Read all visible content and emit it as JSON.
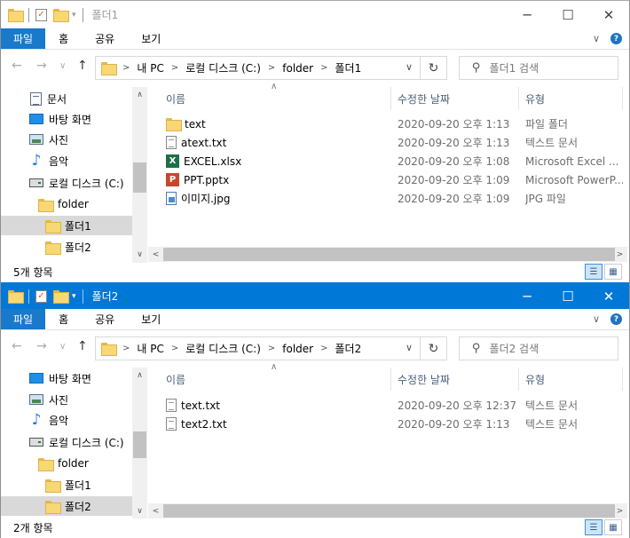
{
  "windows": [
    {
      "title": "폴더1",
      "ribbon_tabs": [
        "파일",
        "홈",
        "공유",
        "보기"
      ],
      "address": {
        "crumbs": [
          "내 PC",
          "로컬 디스크 (C:)",
          "folder",
          "폴더1"
        ]
      },
      "search_placeholder": "폴더1 검색",
      "columns": {
        "name": "이름",
        "date": "수정한 날짜",
        "type": "유형"
      },
      "nav_items": [
        {
          "label": "문서",
          "icon": "documents-icon",
          "selected": false
        },
        {
          "label": "바탕 화면",
          "icon": "desktop-icon",
          "selected": false
        },
        {
          "label": "사진",
          "icon": "pictures-icon",
          "selected": false
        },
        {
          "label": "음악",
          "icon": "music-icon",
          "selected": false
        },
        {
          "label": "로컬 디스크 (C:)",
          "icon": "drive-icon",
          "selected": false
        },
        {
          "label": "folder",
          "icon": "folder-icon",
          "selected": false
        },
        {
          "label": "폴더1",
          "icon": "folder-icon",
          "selected": true
        },
        {
          "label": "폴더2",
          "icon": "folder-icon",
          "selected": false
        }
      ],
      "files": [
        {
          "name": "text",
          "date": "2020-09-20 오후 1:13",
          "type": "파일 폴더",
          "icon": "folder-icon"
        },
        {
          "name": "atext.txt",
          "date": "2020-09-20 오후 1:13",
          "type": "텍스트 문서",
          "icon": "text-file-icon"
        },
        {
          "name": "EXCEL.xlsx",
          "date": "2020-09-20 오후 1:08",
          "type": "Microsoft Excel ...",
          "icon": "excel-file-icon"
        },
        {
          "name": "PPT.pptx",
          "date": "2020-09-20 오후 1:09",
          "type": "Microsoft PowerP...",
          "icon": "powerpoint-file-icon"
        },
        {
          "name": "이미지.jpg",
          "date": "2020-09-20 오후 1:09",
          "type": "JPG 파일",
          "icon": "image-file-icon"
        }
      ],
      "status": "5개 항목"
    },
    {
      "title": "폴더2",
      "ribbon_tabs": [
        "파일",
        "홈",
        "공유",
        "보기"
      ],
      "address": {
        "crumbs": [
          "내 PC",
          "로컬 디스크 (C:)",
          "folder",
          "폴더2"
        ]
      },
      "search_placeholder": "폴더2 검색",
      "columns": {
        "name": "이름",
        "date": "수정한 날짜",
        "type": "유형"
      },
      "nav_items": [
        {
          "label": "바탕 화면",
          "icon": "desktop-icon",
          "selected": false
        },
        {
          "label": "사진",
          "icon": "pictures-icon",
          "selected": false
        },
        {
          "label": "음악",
          "icon": "music-icon",
          "selected": false
        },
        {
          "label": "로컬 디스크 (C:)",
          "icon": "drive-icon",
          "selected": false
        },
        {
          "label": "folder",
          "icon": "folder-icon",
          "selected": false
        },
        {
          "label": "폴더1",
          "icon": "folder-icon",
          "selected": false
        },
        {
          "label": "폴더2",
          "icon": "folder-icon",
          "selected": true
        }
      ],
      "files": [
        {
          "name": "text.txt",
          "date": "2020-09-20 오후 12:37",
          "type": "텍스트 문서",
          "icon": "text-file-icon"
        },
        {
          "name": "text2.txt",
          "date": "2020-09-20 오후 1:13",
          "type": "텍스트 문서",
          "icon": "text-file-icon"
        }
      ],
      "status": "2개 항목"
    }
  ]
}
